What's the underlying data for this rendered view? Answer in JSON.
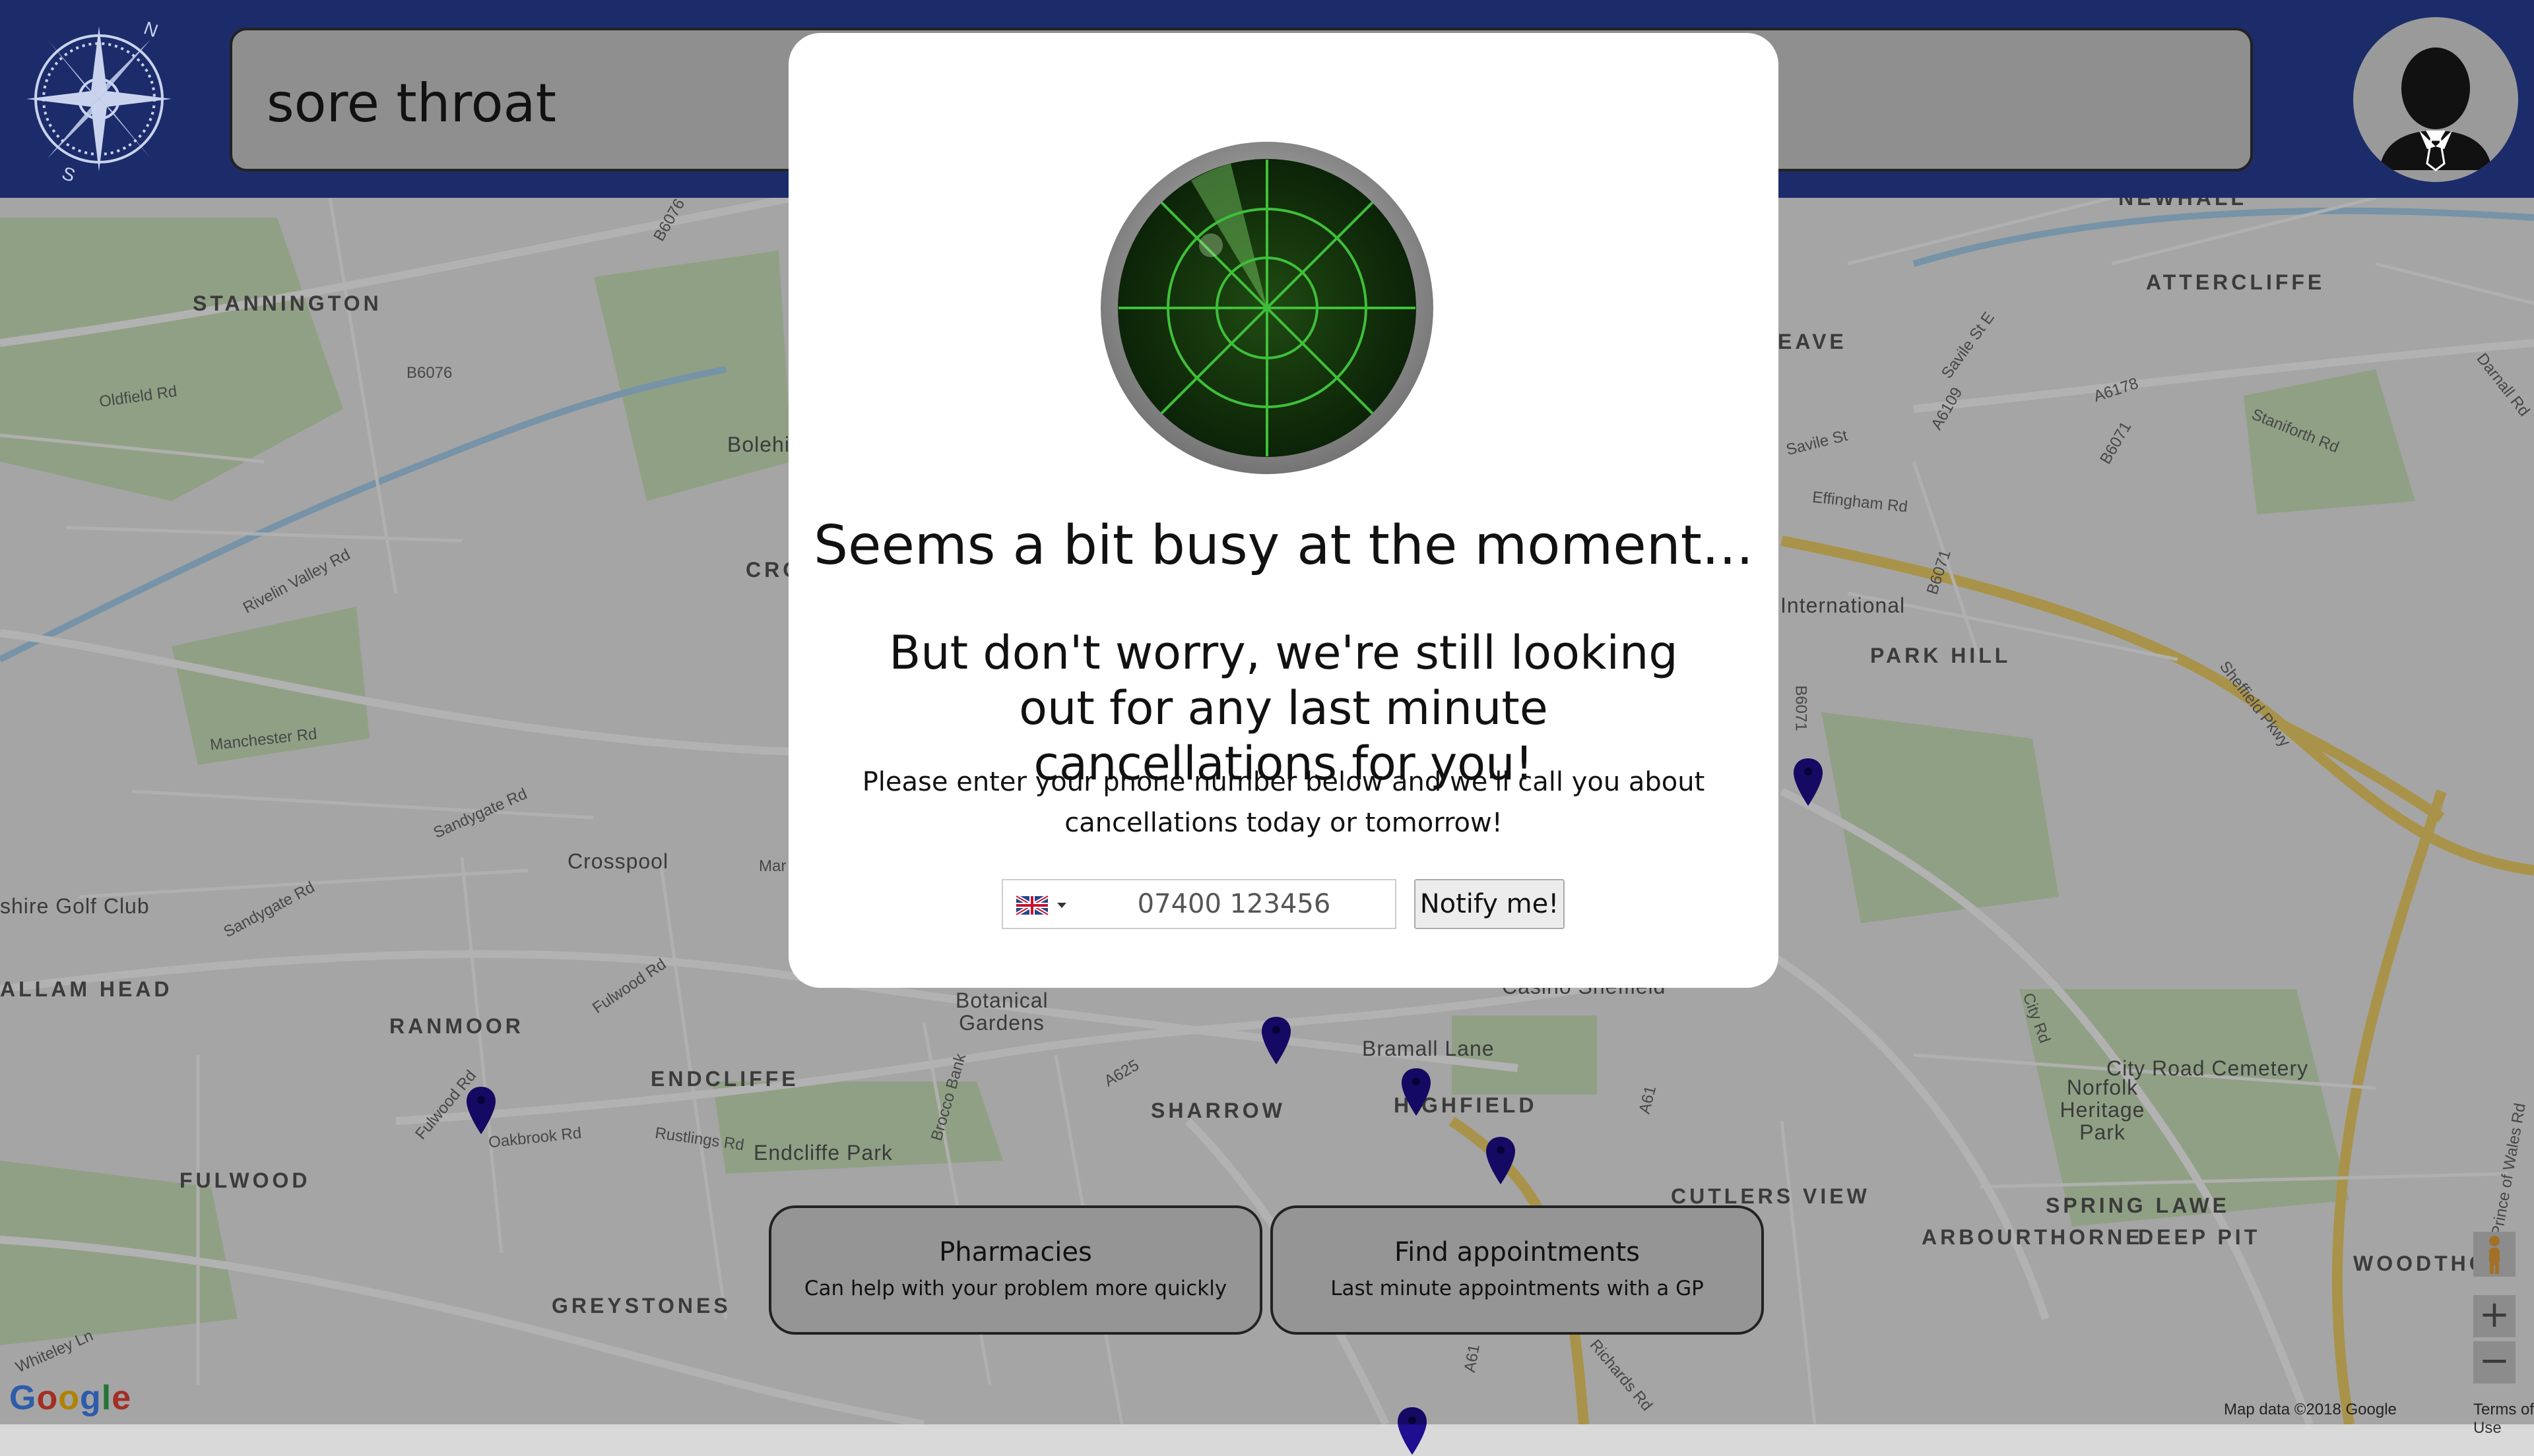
{
  "header": {
    "search_value": "sore throat"
  },
  "modal": {
    "title": "Seems a bit busy at the moment...",
    "subtitle": "But don't worry, we're still looking out for any last minute cancellations for you!",
    "body": "Please enter your phone number below and we'll call you about cancellations today or tomorrow!",
    "phone_placeholder": "07400 123456",
    "notify_label": "Notify me!"
  },
  "cards": [
    {
      "title": "Pharmacies",
      "subtitle": "Can help with your problem more quickly"
    },
    {
      "title": "Find appointments",
      "subtitle": "Last minute appointments with a GP"
    }
  ],
  "map": {
    "area_labels": [
      "STANNINGTON",
      "CRO",
      "ATTERCLIFFE",
      "EAVE",
      "PARK HILL",
      "NEWHALL",
      "ALLAM HEAD",
      "RANMOOR",
      "ENDCLIFFE",
      "SHARROW",
      "HIGHFIELD",
      "FULWOOD",
      "GREYSTONES",
      "CUTLERS VIEW",
      "SPRING LAWE",
      "ARBOURTHORNE",
      "DEEP PIT",
      "WOODTHOR"
    ],
    "place_labels": [
      "Crosspool",
      "Bolehi",
      "International",
      "Norfolk Heritage Park",
      "City Road Cemetery",
      "Bramall Lane",
      "Endcliffe Park",
      "Botanical Gardens",
      "Casino Sheffield",
      "shire Golf Club"
    ],
    "road_labels": [
      "B6076",
      "Oldfield Rd",
      "Rivelin Valley Rd",
      "Manchester Rd",
      "Sandygate Rd",
      "Fulwood Rd",
      "Oakbrook Rd",
      "Rustlings Rd",
      "Brocco Bank",
      "A625",
      "A61",
      "Savile St",
      "Effingham Rd",
      "A6109",
      "A6178",
      "B6071",
      "Staniforth Rd",
      "Sheffield Pkwy",
      "City Rd",
      "Whiteley Ln",
      "Richards Rd",
      "Darnall Rd",
      "Savile St E",
      "Mar",
      "Prince of Wales Rd"
    ],
    "attribution": "Map data ©2018 Google",
    "terms": "Terms of Use",
    "zoom_in": "+",
    "zoom_out": "−",
    "google_logo": "Google"
  },
  "colors": {
    "header_bg": "#1c2c6a",
    "pin": "#1d0f8f",
    "radar_green": "#3c8a2a"
  }
}
